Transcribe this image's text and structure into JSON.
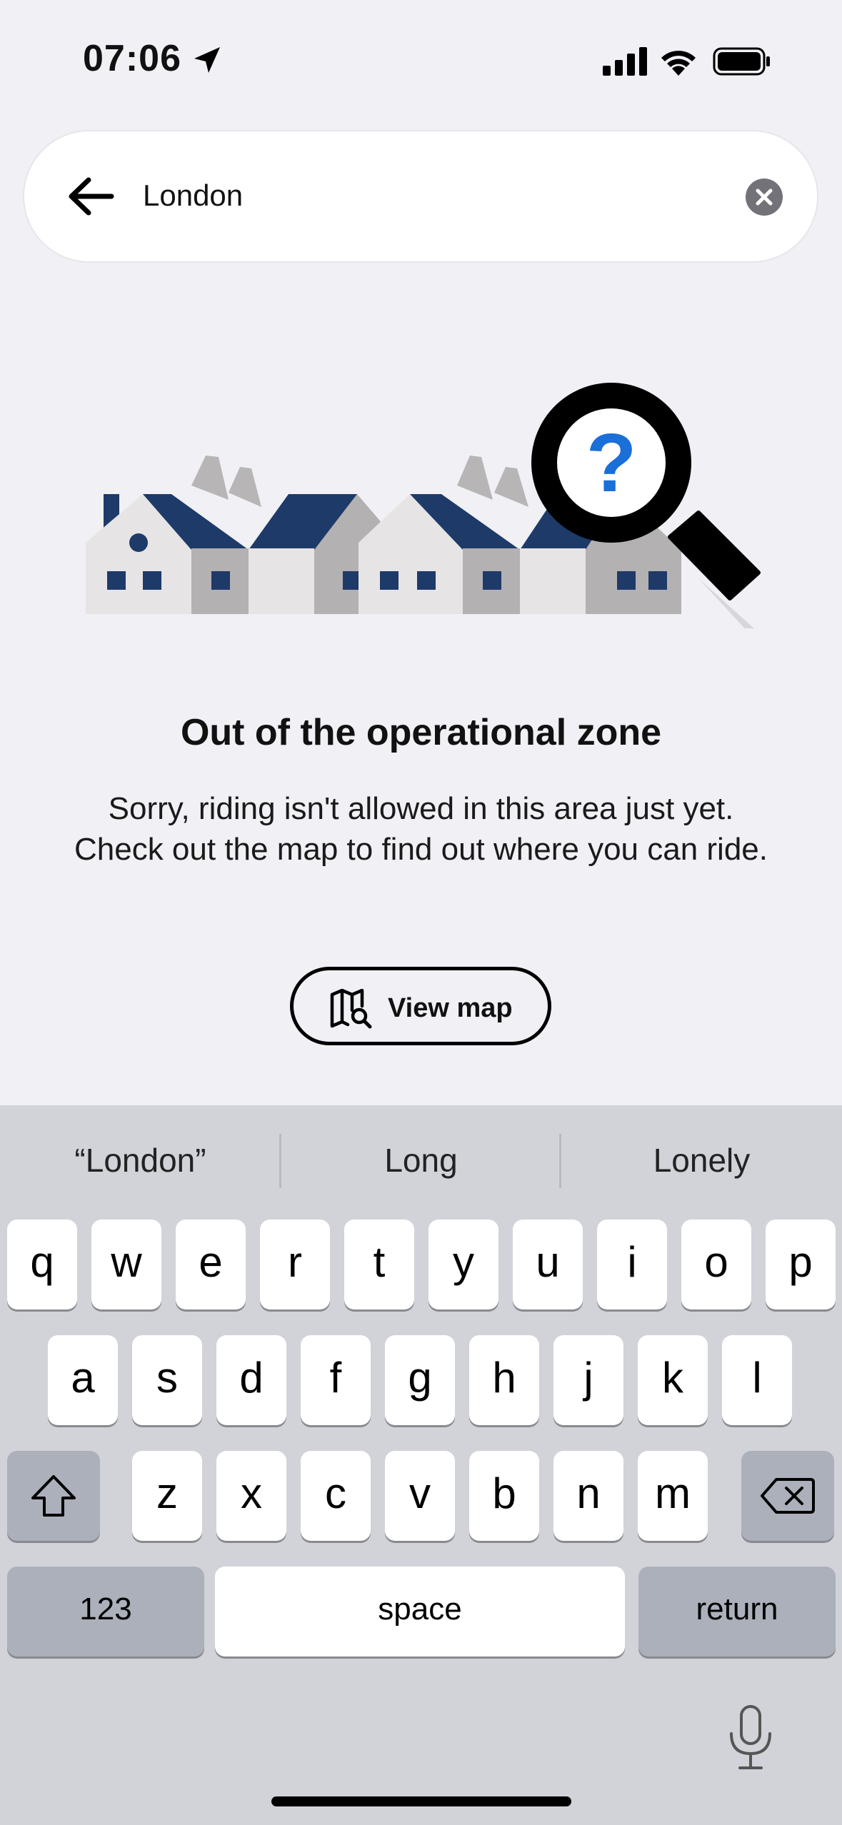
{
  "status_bar": {
    "time": "07:06"
  },
  "search": {
    "value": "London"
  },
  "empty_state": {
    "title": "Out of the operational zone",
    "description": "Sorry, riding isn't allowed in this area just yet. Check out the map to find out where you can ride.",
    "button_label": "View map"
  },
  "illustration": {
    "question_mark": "?"
  },
  "keyboard": {
    "suggestions": [
      "“London”",
      "Long",
      "Lonely"
    ],
    "row1": [
      "q",
      "w",
      "e",
      "r",
      "t",
      "y",
      "u",
      "i",
      "o",
      "p"
    ],
    "row2": [
      "a",
      "s",
      "d",
      "f",
      "g",
      "h",
      "j",
      "k",
      "l"
    ],
    "row3": [
      "z",
      "x",
      "c",
      "v",
      "b",
      "n",
      "m"
    ],
    "numbers_label": "123",
    "space_label": "space",
    "return_label": "return"
  },
  "colors": {
    "accent_blue": "#1a6fd8",
    "roof_navy": "#1e3a68",
    "background": "#f0f0f5"
  },
  "icons": [
    "location-arrow-icon",
    "cellular-signal-icon",
    "wifi-icon",
    "battery-icon",
    "back-arrow-icon",
    "clear-icon",
    "map-search-icon",
    "magnifier-icon",
    "shift-icon",
    "backspace-icon",
    "microphone-icon"
  ]
}
